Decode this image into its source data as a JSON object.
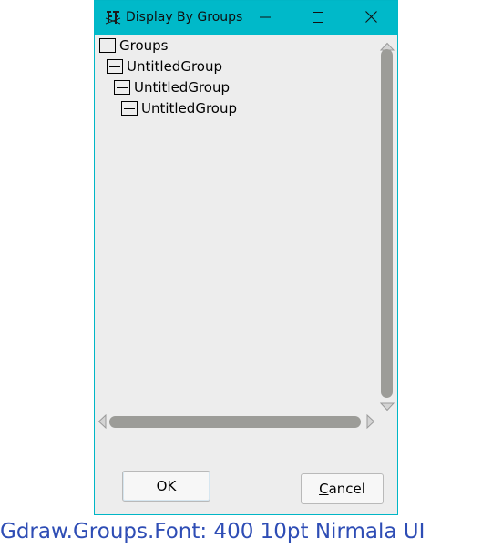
{
  "window": {
    "title": "Display By Groups",
    "app_icon": "fontforge-icon",
    "controls": {
      "minimize": "minimize-icon",
      "maximize": "maximize-icon",
      "close": "close-icon"
    },
    "accent_color": "#00b9c9"
  },
  "tree": {
    "items": [
      {
        "label": "Groups",
        "depth": 0,
        "expanded": true
      },
      {
        "label": "UntitledGroup",
        "depth": 1,
        "expanded": true
      },
      {
        "label": "UntitledGroup",
        "depth": 2,
        "expanded": true
      },
      {
        "label": "UntitledGroup",
        "depth": 3,
        "expanded": true
      }
    ]
  },
  "buttons": {
    "ok": {
      "mnemonic": "O",
      "rest": "K"
    },
    "cancel": {
      "mnemonic": "C",
      "rest": "ancel"
    }
  },
  "caption": {
    "text": "Gdraw.Groups.Font: 400 10pt Nirmala UI",
    "color": "#2e4db5"
  }
}
